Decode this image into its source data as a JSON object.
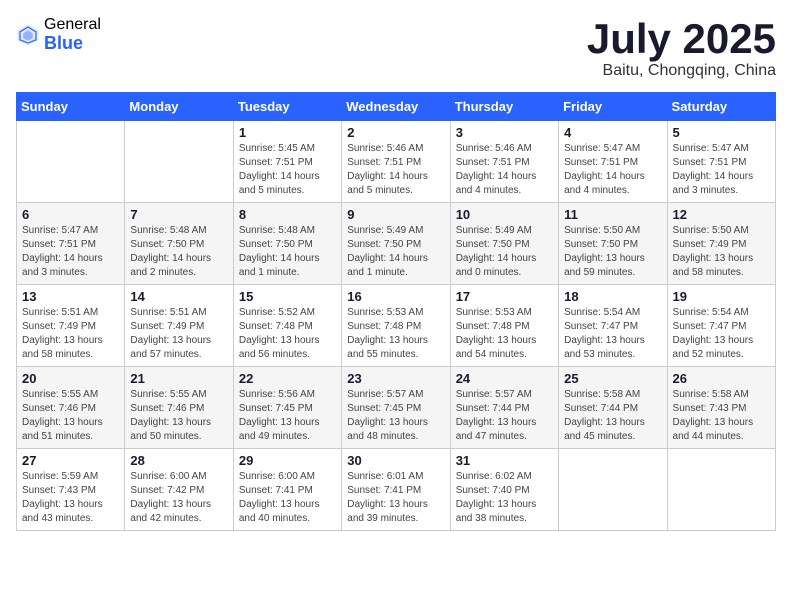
{
  "logo": {
    "general": "General",
    "blue": "Blue"
  },
  "title": {
    "month": "July 2025",
    "location": "Baitu, Chongqing, China"
  },
  "headers": [
    "Sunday",
    "Monday",
    "Tuesday",
    "Wednesday",
    "Thursday",
    "Friday",
    "Saturday"
  ],
  "weeks": [
    [
      {
        "day": "",
        "info": ""
      },
      {
        "day": "",
        "info": ""
      },
      {
        "day": "1",
        "info": "Sunrise: 5:45 AM\nSunset: 7:51 PM\nDaylight: 14 hours and 5 minutes."
      },
      {
        "day": "2",
        "info": "Sunrise: 5:46 AM\nSunset: 7:51 PM\nDaylight: 14 hours and 5 minutes."
      },
      {
        "day": "3",
        "info": "Sunrise: 5:46 AM\nSunset: 7:51 PM\nDaylight: 14 hours and 4 minutes."
      },
      {
        "day": "4",
        "info": "Sunrise: 5:47 AM\nSunset: 7:51 PM\nDaylight: 14 hours and 4 minutes."
      },
      {
        "day": "5",
        "info": "Sunrise: 5:47 AM\nSunset: 7:51 PM\nDaylight: 14 hours and 3 minutes."
      }
    ],
    [
      {
        "day": "6",
        "info": "Sunrise: 5:47 AM\nSunset: 7:51 PM\nDaylight: 14 hours and 3 minutes."
      },
      {
        "day": "7",
        "info": "Sunrise: 5:48 AM\nSunset: 7:50 PM\nDaylight: 14 hours and 2 minutes."
      },
      {
        "day": "8",
        "info": "Sunrise: 5:48 AM\nSunset: 7:50 PM\nDaylight: 14 hours and 1 minute."
      },
      {
        "day": "9",
        "info": "Sunrise: 5:49 AM\nSunset: 7:50 PM\nDaylight: 14 hours and 1 minute."
      },
      {
        "day": "10",
        "info": "Sunrise: 5:49 AM\nSunset: 7:50 PM\nDaylight: 14 hours and 0 minutes."
      },
      {
        "day": "11",
        "info": "Sunrise: 5:50 AM\nSunset: 7:50 PM\nDaylight: 13 hours and 59 minutes."
      },
      {
        "day": "12",
        "info": "Sunrise: 5:50 AM\nSunset: 7:49 PM\nDaylight: 13 hours and 58 minutes."
      }
    ],
    [
      {
        "day": "13",
        "info": "Sunrise: 5:51 AM\nSunset: 7:49 PM\nDaylight: 13 hours and 58 minutes."
      },
      {
        "day": "14",
        "info": "Sunrise: 5:51 AM\nSunset: 7:49 PM\nDaylight: 13 hours and 57 minutes."
      },
      {
        "day": "15",
        "info": "Sunrise: 5:52 AM\nSunset: 7:48 PM\nDaylight: 13 hours and 56 minutes."
      },
      {
        "day": "16",
        "info": "Sunrise: 5:53 AM\nSunset: 7:48 PM\nDaylight: 13 hours and 55 minutes."
      },
      {
        "day": "17",
        "info": "Sunrise: 5:53 AM\nSunset: 7:48 PM\nDaylight: 13 hours and 54 minutes."
      },
      {
        "day": "18",
        "info": "Sunrise: 5:54 AM\nSunset: 7:47 PM\nDaylight: 13 hours and 53 minutes."
      },
      {
        "day": "19",
        "info": "Sunrise: 5:54 AM\nSunset: 7:47 PM\nDaylight: 13 hours and 52 minutes."
      }
    ],
    [
      {
        "day": "20",
        "info": "Sunrise: 5:55 AM\nSunset: 7:46 PM\nDaylight: 13 hours and 51 minutes."
      },
      {
        "day": "21",
        "info": "Sunrise: 5:55 AM\nSunset: 7:46 PM\nDaylight: 13 hours and 50 minutes."
      },
      {
        "day": "22",
        "info": "Sunrise: 5:56 AM\nSunset: 7:45 PM\nDaylight: 13 hours and 49 minutes."
      },
      {
        "day": "23",
        "info": "Sunrise: 5:57 AM\nSunset: 7:45 PM\nDaylight: 13 hours and 48 minutes."
      },
      {
        "day": "24",
        "info": "Sunrise: 5:57 AM\nSunset: 7:44 PM\nDaylight: 13 hours and 47 minutes."
      },
      {
        "day": "25",
        "info": "Sunrise: 5:58 AM\nSunset: 7:44 PM\nDaylight: 13 hours and 45 minutes."
      },
      {
        "day": "26",
        "info": "Sunrise: 5:58 AM\nSunset: 7:43 PM\nDaylight: 13 hours and 44 minutes."
      }
    ],
    [
      {
        "day": "27",
        "info": "Sunrise: 5:59 AM\nSunset: 7:43 PM\nDaylight: 13 hours and 43 minutes."
      },
      {
        "day": "28",
        "info": "Sunrise: 6:00 AM\nSunset: 7:42 PM\nDaylight: 13 hours and 42 minutes."
      },
      {
        "day": "29",
        "info": "Sunrise: 6:00 AM\nSunset: 7:41 PM\nDaylight: 13 hours and 40 minutes."
      },
      {
        "day": "30",
        "info": "Sunrise: 6:01 AM\nSunset: 7:41 PM\nDaylight: 13 hours and 39 minutes."
      },
      {
        "day": "31",
        "info": "Sunrise: 6:02 AM\nSunset: 7:40 PM\nDaylight: 13 hours and 38 minutes."
      },
      {
        "day": "",
        "info": ""
      },
      {
        "day": "",
        "info": ""
      }
    ]
  ]
}
